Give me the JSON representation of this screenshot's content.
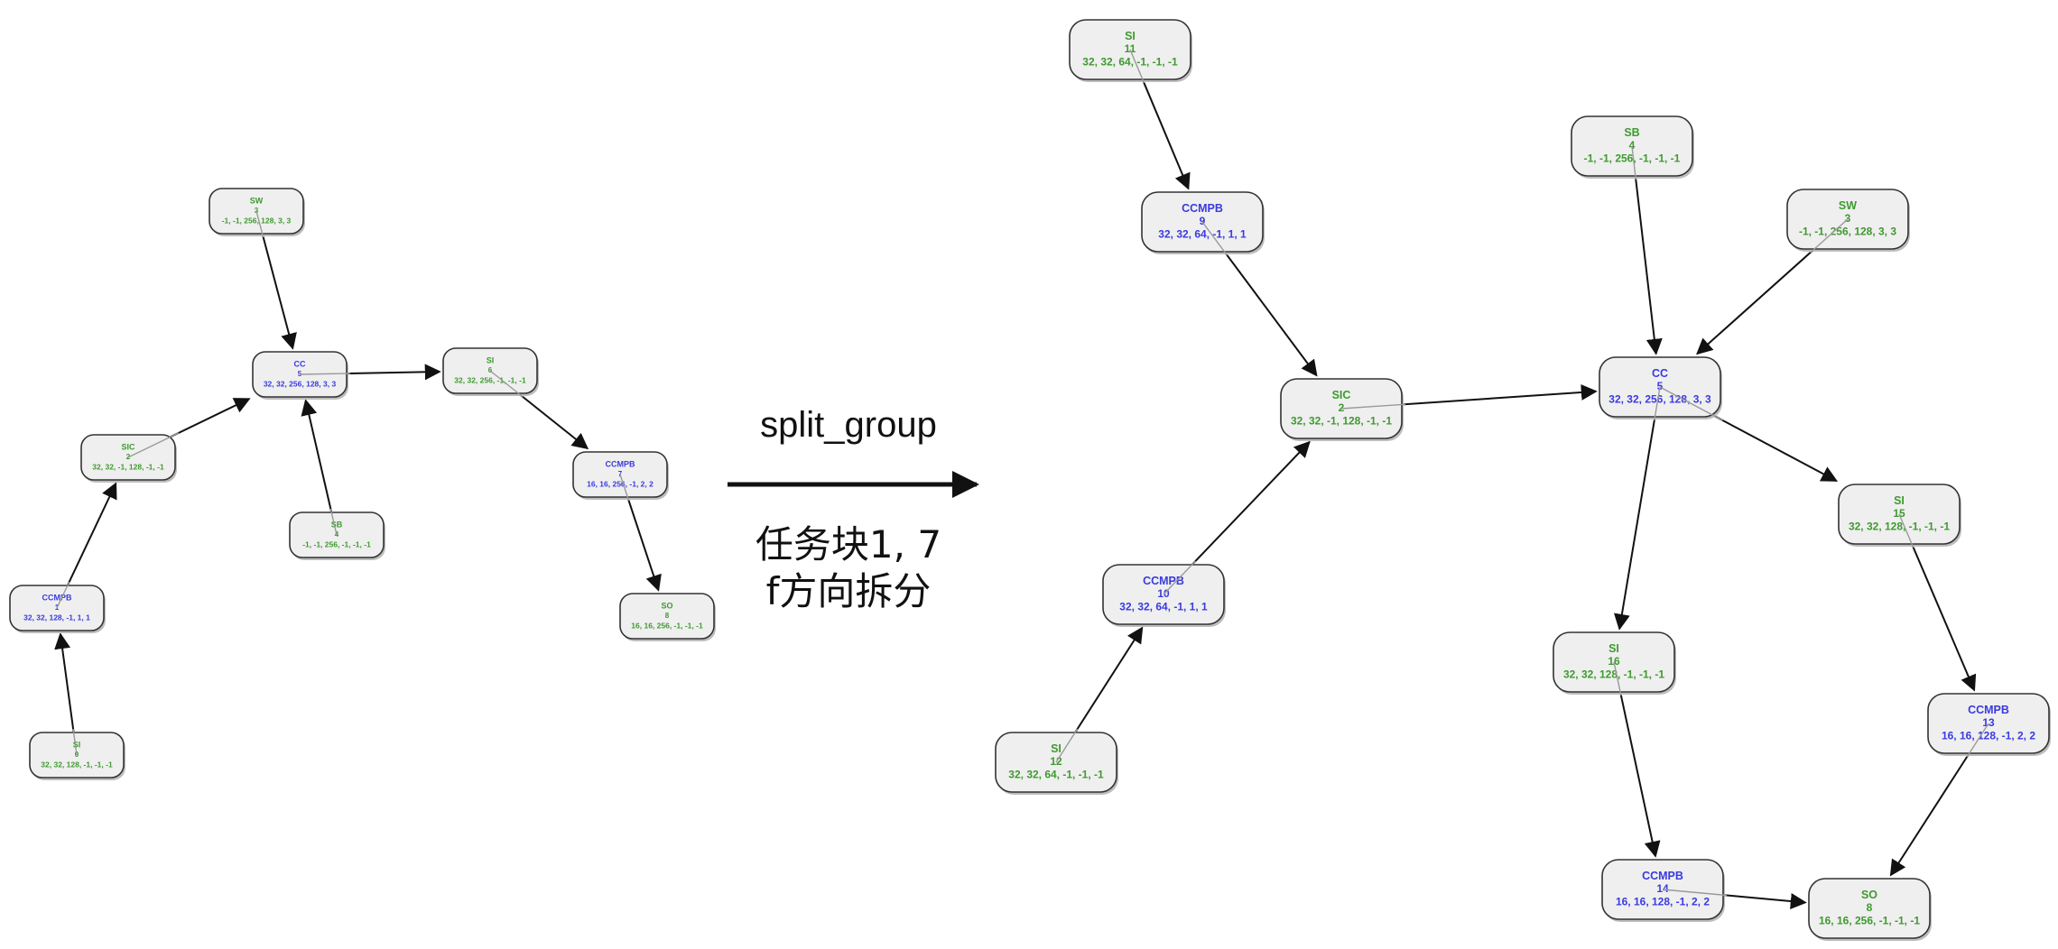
{
  "colors": {
    "green": "#3f9a2f",
    "blue": "#3a3ae0",
    "node_fill": "#efefef",
    "node_border": "#333333",
    "edge": "#111111"
  },
  "transform": {
    "op_label": "split_group",
    "note_line1": "任务块1, 7",
    "note_line2": "f方向拆分"
  },
  "graphs": {
    "before": {
      "nodes": [
        {
          "id": "b3",
          "type": "SW",
          "num": "3",
          "params": "-1, -1, 256, 128, 3, 3",
          "color": "green"
        },
        {
          "id": "b5",
          "type": "CC",
          "num": "5",
          "params": "32, 32, 256, 128, 3, 3",
          "color": "blue"
        },
        {
          "id": "b6",
          "type": "SI",
          "num": "6",
          "params": "32, 32, 256, -1, -1, -1",
          "color": "green"
        },
        {
          "id": "b2",
          "type": "SIC",
          "num": "2",
          "params": "32, 32, -1, 128, -1, -1",
          "color": "green"
        },
        {
          "id": "b7",
          "type": "CCMPB",
          "num": "7",
          "params": "16, 16, 256, -1, 2, 2",
          "color": "blue"
        },
        {
          "id": "b4",
          "type": "SB",
          "num": "4",
          "params": "-1, -1, 256, -1, -1, -1",
          "color": "green"
        },
        {
          "id": "b1",
          "type": "CCMPB",
          "num": "1",
          "params": "32, 32, 128, -1, 1, 1",
          "color": "blue"
        },
        {
          "id": "b8",
          "type": "SO",
          "num": "8",
          "params": "16, 16, 256, -1, -1, -1",
          "color": "green"
        },
        {
          "id": "b0",
          "type": "SI",
          "num": "0",
          "params": "32, 32, 128, -1, -1, -1",
          "color": "green"
        }
      ],
      "edges": [
        {
          "from": "b3",
          "to": "b5"
        },
        {
          "from": "b5",
          "to": "b6"
        },
        {
          "from": "b2",
          "to": "b5"
        },
        {
          "from": "b4",
          "to": "b5"
        },
        {
          "from": "b6",
          "to": "b7"
        },
        {
          "from": "b7",
          "to": "b8"
        },
        {
          "from": "b1",
          "to": "b2"
        },
        {
          "from": "b0",
          "to": "b1"
        }
      ]
    },
    "after": {
      "nodes": [
        {
          "id": "a11",
          "type": "SI",
          "num": "11",
          "params": "32, 32, 64, -1, -1, -1",
          "color": "green"
        },
        {
          "id": "a4",
          "type": "SB",
          "num": "4",
          "params": "-1, -1, 256, -1, -1, -1",
          "color": "green"
        },
        {
          "id": "a9",
          "type": "CCMPB",
          "num": "9",
          "params": "32, 32, 64, -1, 1, 1",
          "color": "blue"
        },
        {
          "id": "a3",
          "type": "SW",
          "num": "3",
          "params": "-1, -1, 256, 128, 3, 3",
          "color": "green"
        },
        {
          "id": "a5",
          "type": "CC",
          "num": "5",
          "params": "32, 32, 256, 128, 3, 3",
          "color": "blue"
        },
        {
          "id": "a2",
          "type": "SIC",
          "num": "2",
          "params": "32, 32, -1, 128, -1, -1",
          "color": "green"
        },
        {
          "id": "a15",
          "type": "SI",
          "num": "15",
          "params": "32, 32, 128, -1, -1, -1",
          "color": "green"
        },
        {
          "id": "a10",
          "type": "CCMPB",
          "num": "10",
          "params": "32, 32, 64, -1, 1, 1",
          "color": "blue"
        },
        {
          "id": "a16",
          "type": "SI",
          "num": "16",
          "params": "32, 32, 128, -1, -1, -1",
          "color": "green"
        },
        {
          "id": "a13",
          "type": "CCMPB",
          "num": "13",
          "params": "16, 16, 128, -1, 2, 2",
          "color": "blue"
        },
        {
          "id": "a12",
          "type": "SI",
          "num": "12",
          "params": "32, 32, 64, -1, -1, -1",
          "color": "green"
        },
        {
          "id": "a14",
          "type": "CCMPB",
          "num": "14",
          "params": "16, 16, 128, -1, 2, 2",
          "color": "blue"
        },
        {
          "id": "a8",
          "type": "SO",
          "num": "8",
          "params": "16, 16, 256, -1, -1, -1",
          "color": "green"
        }
      ],
      "edges": [
        {
          "from": "a11",
          "to": "a9"
        },
        {
          "from": "a9",
          "to": "a2"
        },
        {
          "from": "a4",
          "to": "a5"
        },
        {
          "from": "a3",
          "to": "a5"
        },
        {
          "from": "a2",
          "to": "a5"
        },
        {
          "from": "a5",
          "to": "a15"
        },
        {
          "from": "a5",
          "to": "a16"
        },
        {
          "from": "a12",
          "to": "a10"
        },
        {
          "from": "a10",
          "to": "a2"
        },
        {
          "from": "a15",
          "to": "a13"
        },
        {
          "from": "a16",
          "to": "a14"
        },
        {
          "from": "a13",
          "to": "a8"
        },
        {
          "from": "a14",
          "to": "a8"
        }
      ]
    }
  }
}
